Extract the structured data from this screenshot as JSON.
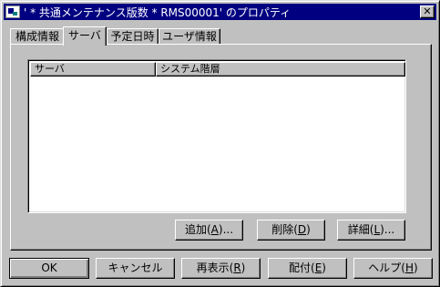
{
  "window": {
    "title": "' * 共通メンテナンス版数 * RMS00001' のプロパティ"
  },
  "tabs": [
    {
      "label": "構成情報"
    },
    {
      "label": "サーバ"
    },
    {
      "label": "予定日時"
    },
    {
      "label": "ユーザ情報"
    }
  ],
  "active_tab": "サーバ",
  "list": {
    "columns": [
      {
        "label": "サーバ"
      },
      {
        "label": "システム階層"
      }
    ],
    "rows": []
  },
  "panel_buttons": {
    "add": {
      "label": "追加(",
      "mnemonic": "A",
      "suffix": ")..."
    },
    "delete": {
      "label": "削除(",
      "mnemonic": "D",
      "suffix": ")"
    },
    "details": {
      "label": "詳細(",
      "mnemonic": "L",
      "suffix": ")..."
    }
  },
  "dialog_buttons": {
    "ok": {
      "label": "OK"
    },
    "cancel": {
      "label": "キャンセル"
    },
    "refresh": {
      "label": "再表示(",
      "mnemonic": "R",
      "suffix": ")"
    },
    "distribute": {
      "label": "配付(",
      "mnemonic": "E",
      "suffix": ")"
    },
    "help": {
      "label": "ヘルプ(",
      "mnemonic": "H",
      "suffix": ")"
    }
  }
}
